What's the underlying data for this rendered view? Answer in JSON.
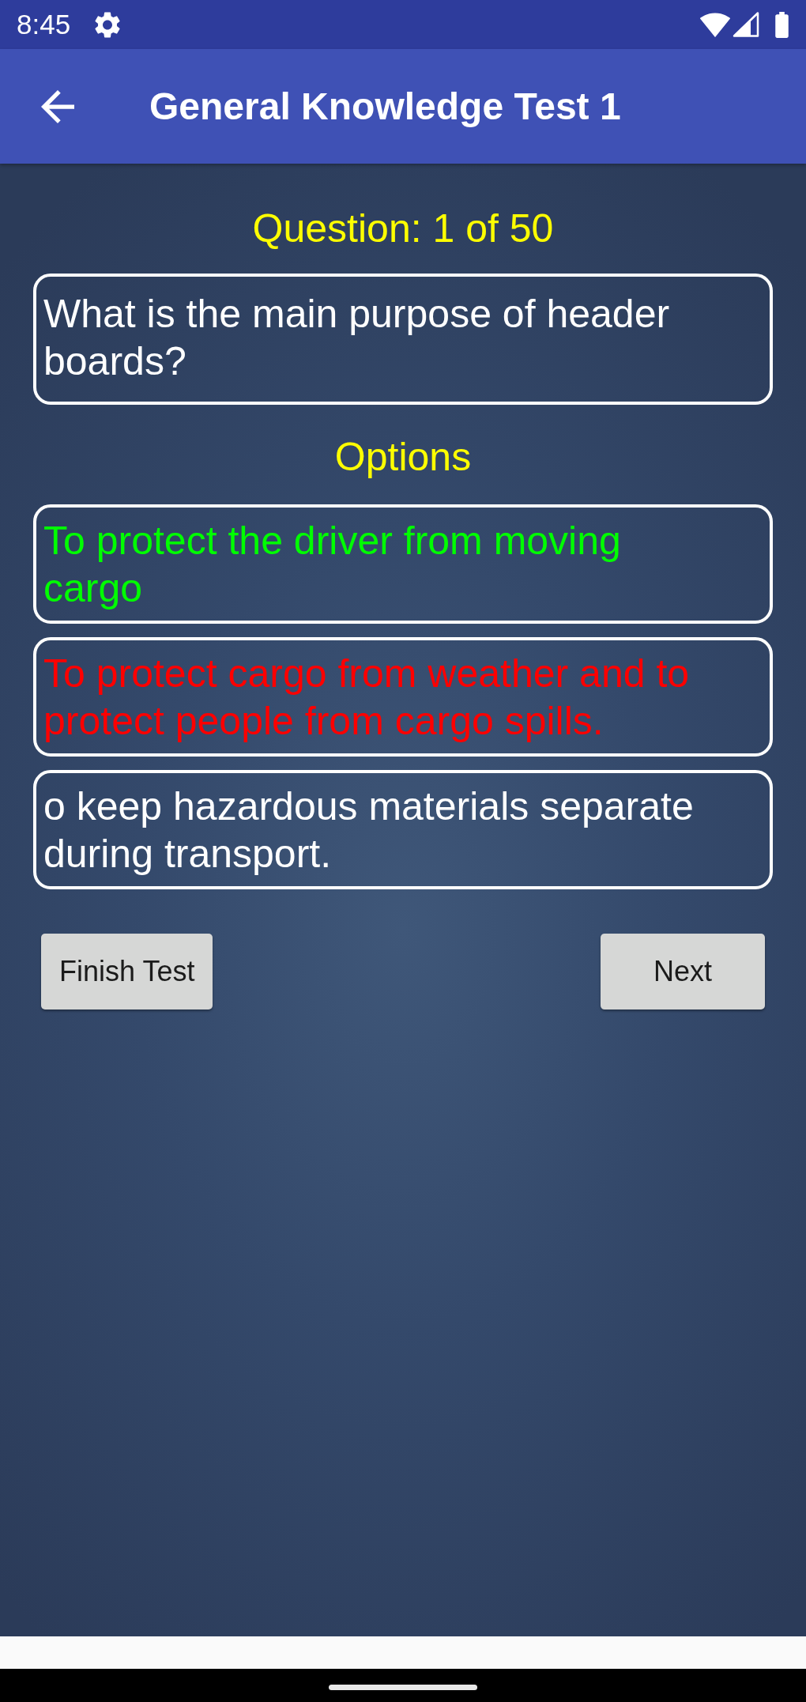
{
  "status_bar": {
    "time": "8:45"
  },
  "app_bar": {
    "title": "General Knowledge Test 1"
  },
  "quiz": {
    "progress": "Question: 1 of 50",
    "question": "What is the main purpose of header boards?",
    "options_heading": "Options",
    "options": [
      {
        "text": "To protect the driver from moving cargo",
        "kind": "correct"
      },
      {
        "text": "To protect cargo from weather and to protect people from cargo spills.",
        "kind": "wrong"
      },
      {
        "text": "o keep hazardous materials separate during transport.",
        "kind": "plain"
      }
    ]
  },
  "buttons": [
    {
      "label": "Finish Test"
    },
    {
      "label": "Next"
    }
  ]
}
